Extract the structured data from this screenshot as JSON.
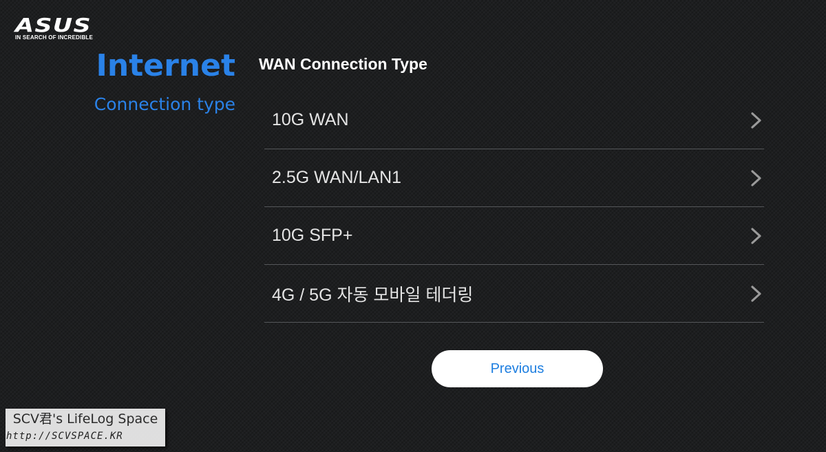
{
  "brand": {
    "logo_text": "ASUS",
    "tagline": "IN SEARCH OF INCREDIBLE"
  },
  "sidebar": {
    "title": "Internet",
    "subtitle": "Connection type"
  },
  "main": {
    "section_title": "WAN Connection Type",
    "options": [
      {
        "label": "10G WAN",
        "icon": "chevron-right-icon"
      },
      {
        "label": "2.5G WAN/LAN1",
        "icon": "chevron-right-icon"
      },
      {
        "label": "10G SFP+",
        "icon": "chevron-right-icon"
      },
      {
        "label": "4G / 5G 자동 모바일 테더링",
        "icon": "chevron-right-icon"
      }
    ],
    "previous_label": "Previous"
  },
  "watermark": {
    "title": "SCV君's LifeLog Space",
    "url": "http://SCVSPACE.KR"
  },
  "colors": {
    "accent": "#2a82e8",
    "background": "#1d1e20",
    "button_bg": "#ffffff",
    "button_text": "#1d7ee0"
  }
}
